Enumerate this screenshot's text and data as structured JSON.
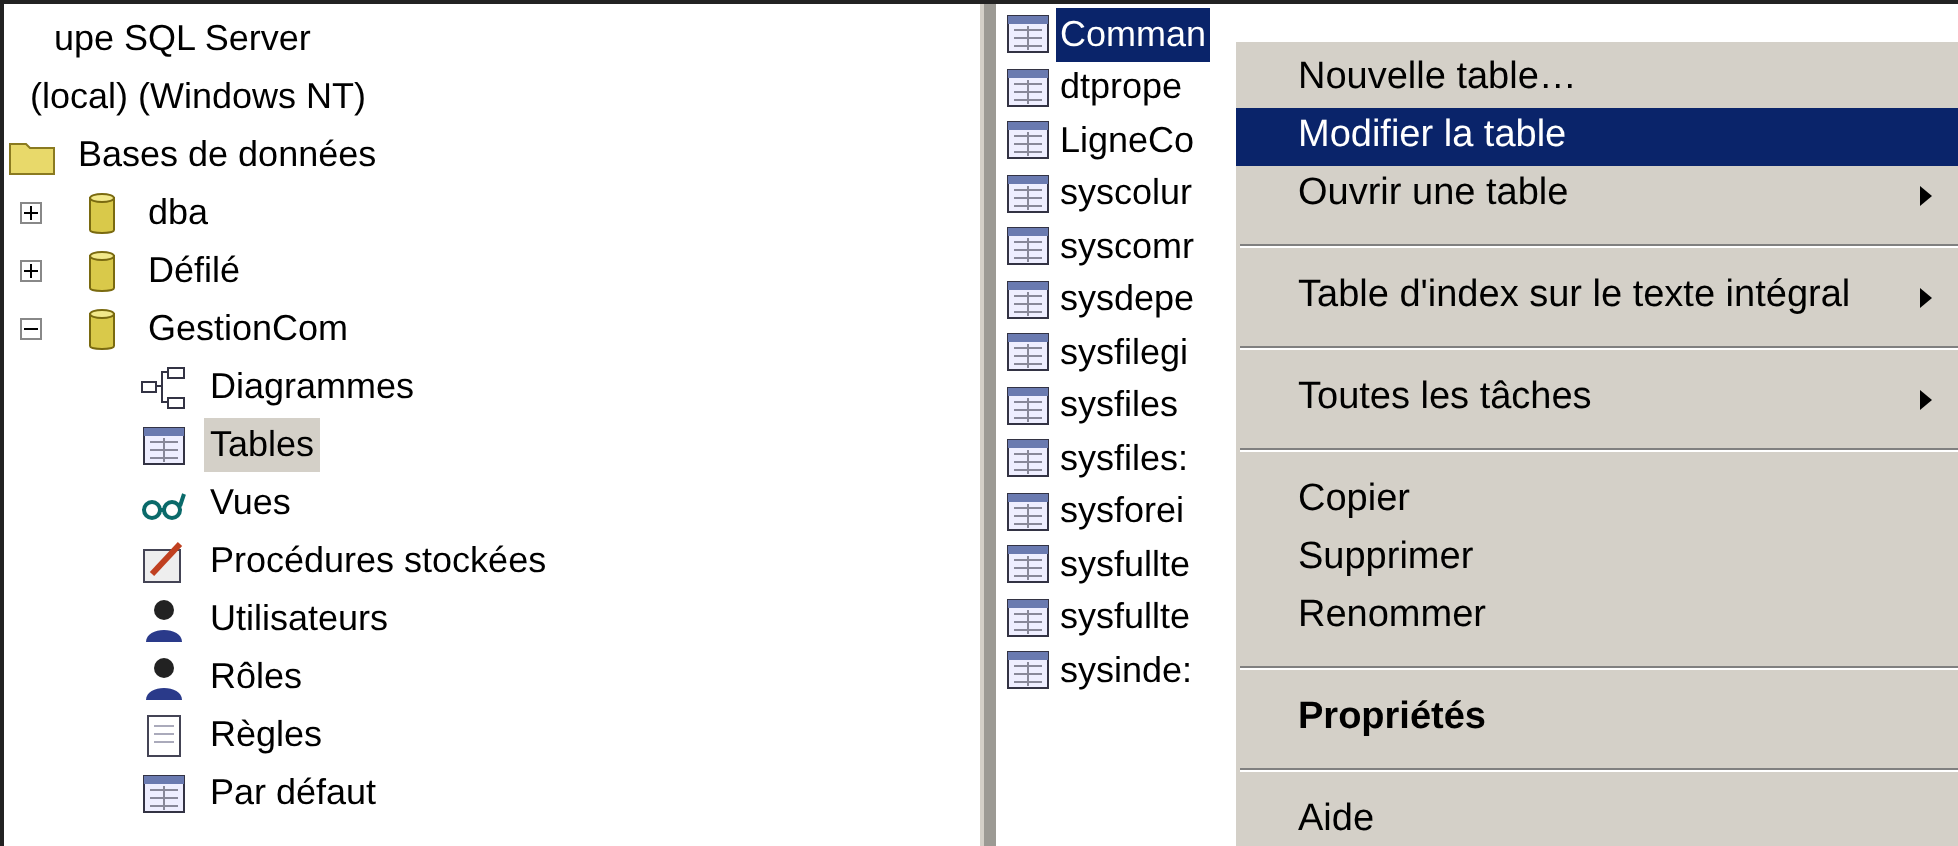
{
  "tree": [
    {
      "label": "upe SQL Server",
      "selected": false,
      "children": [
        {
          "label": "(local) (Windows NT)",
          "selected": false,
          "children": [
            {
              "label": "Bases de données",
              "kind": "folder",
              "selected": false,
              "children": [
                {
                  "label": "dba",
                  "kind": "database",
                  "expanded": false,
                  "selected": false
                },
                {
                  "label": "Défilé",
                  "kind": "database",
                  "expanded": false,
                  "selected": false
                },
                {
                  "label": "GestionCom",
                  "kind": "database",
                  "expanded": true,
                  "selected": false,
                  "children": [
                    {
                      "label": "Diagrammes",
                      "kind": "diagram",
                      "selected": false
                    },
                    {
                      "label": "Tables",
                      "kind": "table",
                      "selected": true
                    },
                    {
                      "label": "Vues",
                      "kind": "view",
                      "selected": false
                    },
                    {
                      "label": "Procédures stockées",
                      "kind": "procedure",
                      "selected": false
                    },
                    {
                      "label": "Utilisateurs",
                      "kind": "user",
                      "selected": false
                    },
                    {
                      "label": "Rôles",
                      "kind": "user",
                      "selected": false
                    },
                    {
                      "label": "Règles",
                      "kind": "rule",
                      "selected": false
                    },
                    {
                      "label": "Par défaut",
                      "kind": "table",
                      "selected": false
                    }
                  ]
                }
              ]
            }
          ]
        }
      ]
    }
  ],
  "list": [
    {
      "name": "Comman",
      "selected": true
    },
    {
      "name": "dtprope",
      "selected": false
    },
    {
      "name": "LigneCo",
      "selected": false
    },
    {
      "name": "syscolur",
      "selected": false
    },
    {
      "name": "syscomr",
      "selected": false
    },
    {
      "name": "sysdepe",
      "selected": false
    },
    {
      "name": "sysfilegi",
      "selected": false
    },
    {
      "name": "sysfiles",
      "selected": false
    },
    {
      "name": "sysfiles:",
      "selected": false
    },
    {
      "name": "sysforei",
      "selected": false
    },
    {
      "name": "sysfullte",
      "selected": false
    },
    {
      "name": "sysfullte",
      "selected": false
    },
    {
      "name": "sysinde:",
      "selected": false
    }
  ],
  "context_menu": [
    {
      "kind": "item",
      "label": "Nouvelle table…",
      "selected": false,
      "submenu": false
    },
    {
      "kind": "item",
      "label": "Modifier la table",
      "selected": true,
      "submenu": false
    },
    {
      "kind": "item",
      "label": "Ouvrir une table",
      "selected": false,
      "submenu": true
    },
    {
      "kind": "separator"
    },
    {
      "kind": "item",
      "label": "Table d'index sur le texte intégral",
      "selected": false,
      "submenu": true
    },
    {
      "kind": "separator"
    },
    {
      "kind": "item",
      "label": "Toutes les tâches",
      "selected": false,
      "submenu": true
    },
    {
      "kind": "separator"
    },
    {
      "kind": "item",
      "label": "Copier",
      "selected": false,
      "submenu": false
    },
    {
      "kind": "item",
      "label": "Supprimer",
      "selected": false,
      "submenu": false
    },
    {
      "kind": "item",
      "label": "Renommer",
      "selected": false,
      "submenu": false
    },
    {
      "kind": "separator"
    },
    {
      "kind": "item",
      "label": "Propriétés",
      "selected": false,
      "submenu": false,
      "default": true
    },
    {
      "kind": "separator"
    },
    {
      "kind": "item",
      "label": "Aide",
      "selected": false,
      "submenu": false
    }
  ]
}
